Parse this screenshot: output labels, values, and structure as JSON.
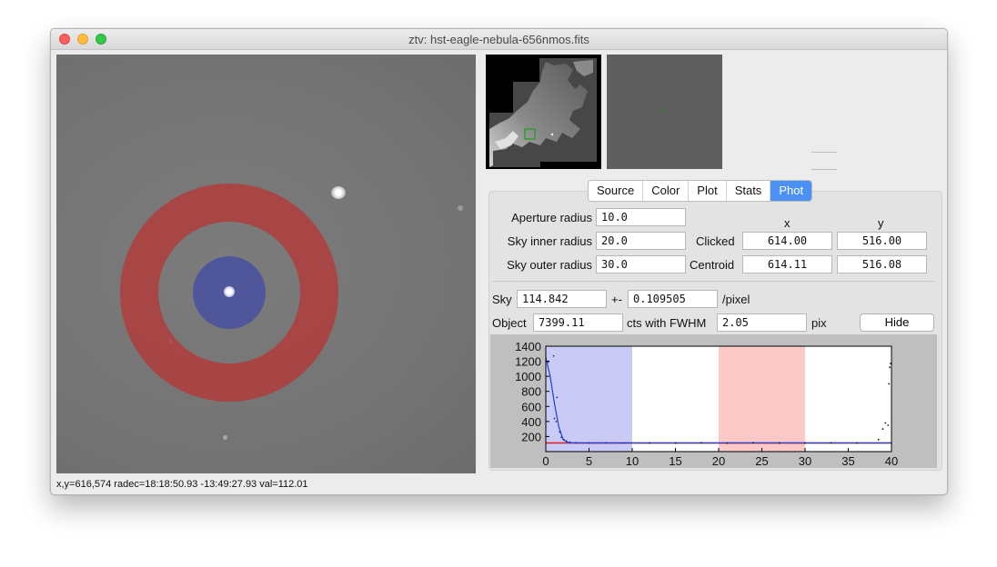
{
  "window": {
    "title": "ztv: hst-eagle-nebula-656nmos.fits"
  },
  "status_bar": {
    "text": "x,y=616,574  radec=18:18:50.93 -13:49:27.93  val=112.01"
  },
  "tabs": [
    {
      "label": "Source"
    },
    {
      "label": "Color"
    },
    {
      "label": "Plot"
    },
    {
      "label": "Stats"
    },
    {
      "label": "Phot",
      "active": true
    }
  ],
  "phot": {
    "aperture_label": "Aperture radius",
    "aperture_value": "10.0",
    "sky_inner_label": "Sky inner radius",
    "sky_inner_value": "20.0",
    "sky_outer_label": "Sky outer radius",
    "sky_outer_value": "30.0",
    "col_x": "x",
    "col_y": "y",
    "clicked_label": "Clicked",
    "clicked_x": "614.00",
    "clicked_y": "516.00",
    "centroid_label": "Centroid",
    "centroid_x": "614.11",
    "centroid_y": "516.08",
    "sky_label": "Sky",
    "sky_value": "114.842",
    "pm_label": "+-",
    "sky_err": "0.109505",
    "per_pixel": "/pixel",
    "object_label": "Object",
    "object_value": "7399.11",
    "cts_label": "cts with FWHM",
    "fwhm_value": "2.05",
    "pix_label": "pix",
    "hide_label": "Hide"
  },
  "colors": {
    "aperture": "#4850a0",
    "annulus": "#b23a3a",
    "tab_active": "#4a90f5",
    "profile": "#1f3fd6"
  },
  "chart_data": {
    "type": "scatter",
    "xlim": [
      0,
      40
    ],
    "ylim": [
      0,
      1400
    ],
    "x_ticks": [
      0,
      5,
      10,
      15,
      20,
      25,
      30,
      35,
      40
    ],
    "y_ticks": [
      200,
      400,
      600,
      800,
      1000,
      1200,
      1400
    ],
    "aperture_band": [
      0,
      10
    ],
    "sky_band": [
      20,
      30
    ],
    "sky_level": 114.842,
    "fit_line": [
      [
        0,
        1250
      ],
      [
        0.5,
        1000
      ],
      [
        1,
        640
      ],
      [
        1.5,
        330
      ],
      [
        2,
        160
      ],
      [
        2.5,
        122
      ],
      [
        3,
        116
      ],
      [
        4,
        115
      ],
      [
        10,
        115
      ],
      [
        40,
        115
      ]
    ],
    "points": [
      [
        0.3,
        1190
      ],
      [
        0.9,
        1270
      ],
      [
        1.3,
        720
      ],
      [
        1.0,
        440
      ],
      [
        1.2,
        400
      ],
      [
        1.6,
        260
      ],
      [
        1.8,
        190
      ],
      [
        2.1,
        160
      ],
      [
        2.4,
        140
      ],
      [
        2.8,
        125
      ],
      [
        3.5,
        118
      ],
      [
        5,
        114
      ],
      [
        7,
        116
      ],
      [
        9,
        113
      ],
      [
        12,
        115
      ],
      [
        15,
        114
      ],
      [
        18,
        116
      ],
      [
        21,
        113
      ],
      [
        24,
        117
      ],
      [
        27,
        114
      ],
      [
        30,
        115
      ],
      [
        33,
        116
      ],
      [
        36,
        114
      ],
      [
        38.5,
        160
      ],
      [
        39.0,
        300
      ],
      [
        39.3,
        380
      ],
      [
        39.6,
        350
      ],
      [
        39.8,
        1120
      ],
      [
        39.9,
        1170
      ],
      [
        39.7,
        900
      ]
    ]
  }
}
